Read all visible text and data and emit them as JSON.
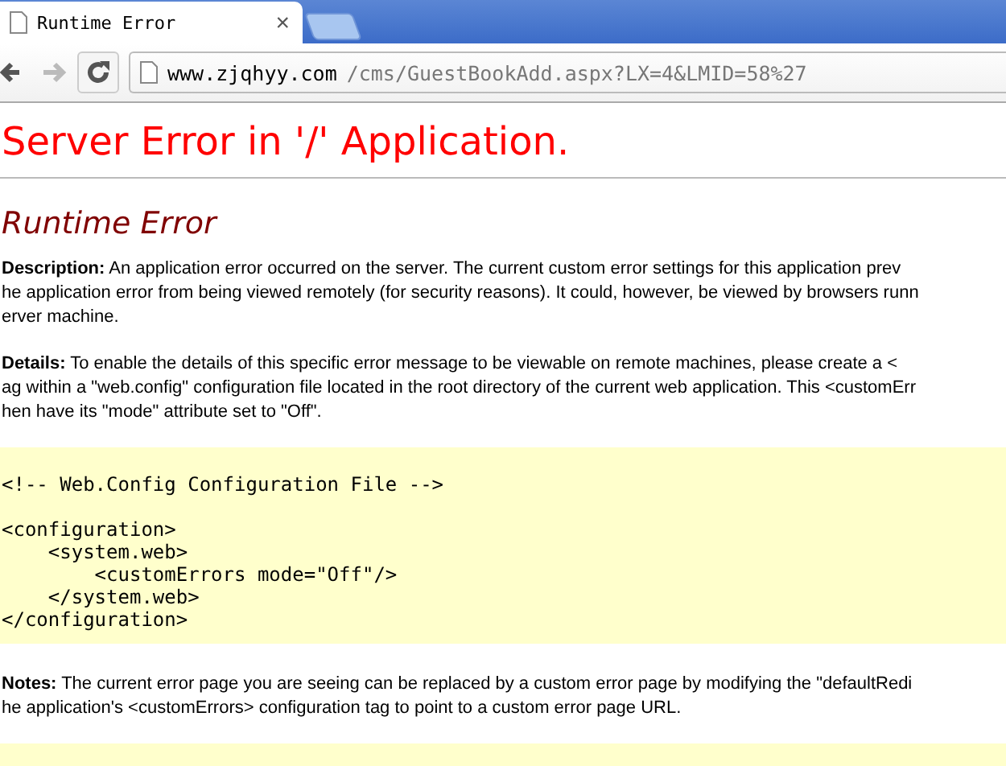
{
  "browser": {
    "tabs": [
      {
        "title": "Runtime Error",
        "selected": true,
        "close": "×"
      },
      {
        "selected": false
      }
    ],
    "address": {
      "host": "www.zjqhyy.com",
      "path": "/cms/GuestBookAdd.aspx?LX=4&LMID=58%27"
    }
  },
  "page": {
    "heading": "Server Error in '/' Application.",
    "subheading": "Runtime Error",
    "sections": [
      {
        "kind": "text",
        "lines": [
          "**Description:** An application error occurred on the server. The current custom error settings for this application prev",
          "he application error from being viewed remotely (for security reasons). It could, however, be viewed by browsers runn",
          "erver machine."
        ]
      },
      {
        "kind": "text",
        "lines": [
          "**Details:** To enable the details of this specific error message to be viewable on remote machines, please create a <",
          "ag within a \"web.config\" configuration file located in the root directory of the current web application. This <customErr",
          "hen have its \"mode\" attribute set to \"Off\"."
        ]
      },
      {
        "kind": "code",
        "comment": "<!-- Web.Config Configuration File -->",
        "lines": [
          "<configuration>",
          "    <system.web>",
          "        <customErrors mode=\"Off\"/>",
          "    </system.web>",
          "</configuration>"
        ]
      },
      {
        "kind": "text",
        "lines": [
          "**Notes:** The current error page you are seeing can be replaced by a custom error page by modifying the \"defaultRedi",
          "he application's <customErrors> configuration tag to point to a custom error page URL."
        ]
      },
      {
        "kind": "code"
      }
    ]
  }
}
